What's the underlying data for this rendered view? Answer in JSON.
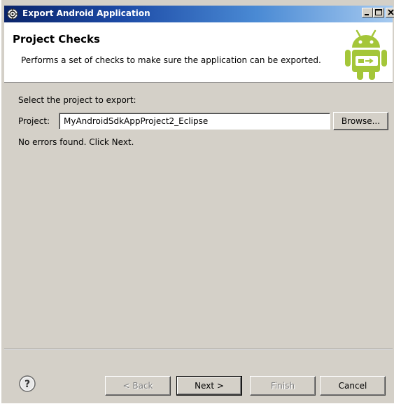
{
  "window": {
    "title": "Export Android Application"
  },
  "header": {
    "title": "Project Checks",
    "description": "Performs a set of checks to make sure the application can be exported."
  },
  "form": {
    "select_label": "Select the project to export:",
    "project_label": "Project:",
    "project_value": "MyAndroidSdkAppProject2_Eclipse",
    "browse_label": "Browse...",
    "status": "No errors found. Click Next."
  },
  "footer": {
    "back_label": "< Back",
    "next_label": "Next >",
    "finish_label": "Finish",
    "cancel_label": "Cancel"
  },
  "colors": {
    "title_gradient_start": "#0a246a",
    "title_gradient_end": "#a6caf0",
    "android_green": "#a4c639",
    "dialog_face": "#d4d0c8"
  },
  "icons": [
    "eclipse-gear-icon",
    "minimize-icon",
    "maximize-icon",
    "close-icon",
    "android-logo-icon",
    "help-icon"
  ]
}
